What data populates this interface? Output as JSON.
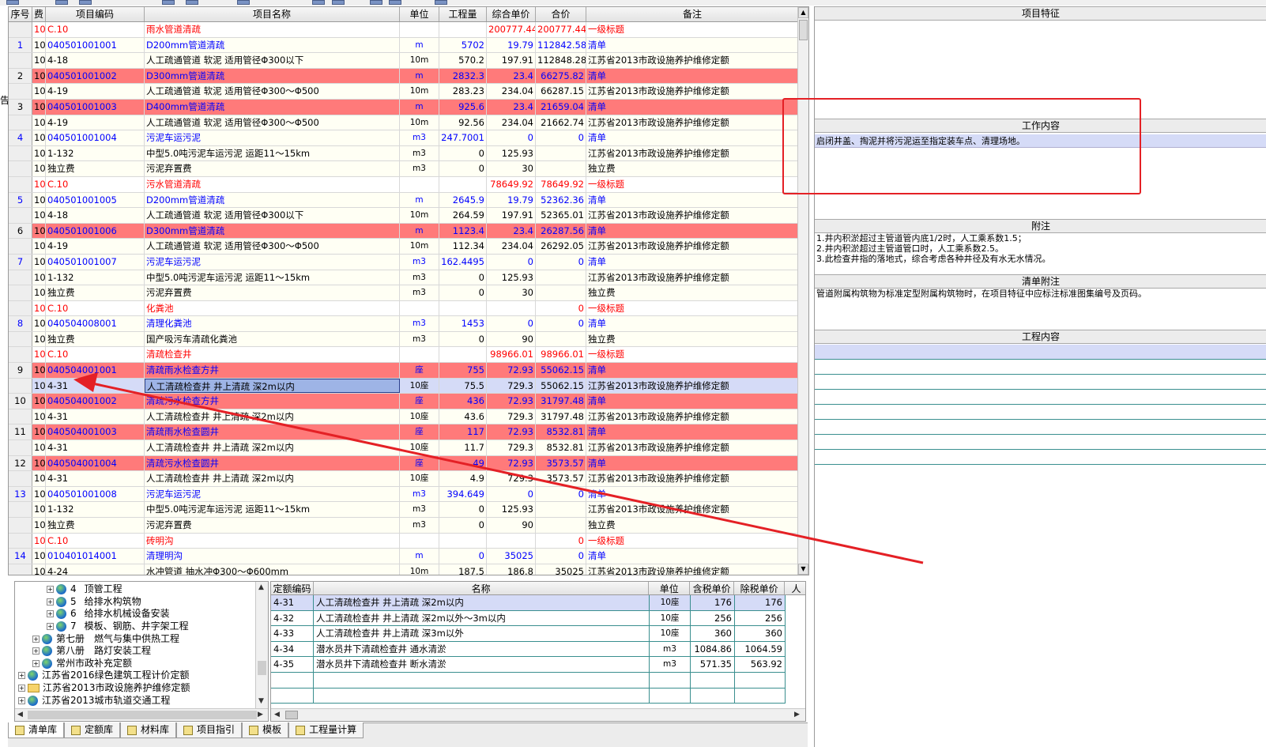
{
  "left_edge_glyph": "告",
  "main_grid": {
    "columns": [
      "序号",
      "费",
      "项目编码",
      "项目名称",
      "单位",
      "工程量",
      "综合单价",
      "合价",
      "备注"
    ],
    "rows": [
      {
        "type": "level1",
        "seq": "",
        "fee": "10",
        "code": "C.10",
        "name": "雨水管道清疏",
        "unit": "",
        "qty": "",
        "price": "200777.44",
        "total": "200777.44",
        "note": "一级标题"
      },
      {
        "type": "item",
        "seq": "1",
        "fee": "10",
        "code": "040501001001",
        "name": "D200mm管道清疏",
        "unit": "m",
        "qty": "5702",
        "price": "19.79",
        "total": "112842.58",
        "note": "清单"
      },
      {
        "type": "quota",
        "seq": "",
        "fee": "10",
        "code": "4-18",
        "name": "人工疏通管道 软泥 适用管径Φ300以下",
        "unit": "10m",
        "qty": "570.2",
        "price": "197.91",
        "total": "112848.28",
        "note": "江苏省2013市政设施养护维修定额"
      },
      {
        "type": "err",
        "seq": "2",
        "fee": "10",
        "code": "040501001002",
        "name": "D300mm管道清疏",
        "unit": "m",
        "qty": "2832.3",
        "price": "23.4",
        "total": "66275.82",
        "note": "清单"
      },
      {
        "type": "quota",
        "seq": "",
        "fee": "10",
        "code": "4-19",
        "name": "人工疏通管道 软泥 适用管径Φ300～Φ500",
        "unit": "10m",
        "qty": "283.23",
        "price": "234.04",
        "total": "66287.15",
        "note": "江苏省2013市政设施养护维修定额"
      },
      {
        "type": "err",
        "seq": "3",
        "fee": "10",
        "code": "040501001003",
        "name": "D400mm管道清疏",
        "unit": "m",
        "qty": "925.6",
        "price": "23.4",
        "total": "21659.04",
        "note": "清单"
      },
      {
        "type": "quota",
        "seq": "",
        "fee": "10",
        "code": "4-19",
        "name": "人工疏通管道 软泥 适用管径Φ300～Φ500",
        "unit": "10m",
        "qty": "92.56",
        "price": "234.04",
        "total": "21662.74",
        "note": "江苏省2013市政设施养护维修定额"
      },
      {
        "type": "item",
        "seq": "4",
        "fee": "10",
        "code": "040501001004",
        "name": "污泥车运污泥",
        "unit": "m3",
        "qty": "247.7001",
        "price": "0",
        "total": "0",
        "note": "清单"
      },
      {
        "type": "quota",
        "seq": "",
        "fee": "10",
        "code": "1-132",
        "name": "中型5.0吨污泥车运污泥 运距11～15km",
        "unit": "m3",
        "qty": "0",
        "price": "125.93",
        "total": "",
        "note": "江苏省2013市政设施养护维修定额"
      },
      {
        "type": "quota",
        "seq": "",
        "fee": "10",
        "code": "独立费",
        "name": "污泥弃置费",
        "unit": "m3",
        "qty": "0",
        "price": "30",
        "total": "",
        "note": "独立费"
      },
      {
        "type": "level1",
        "seq": "",
        "fee": "10",
        "code": "C.10",
        "name": "污水管道清疏",
        "unit": "",
        "qty": "",
        "price": "78649.92",
        "total": "78649.92",
        "note": "一级标题"
      },
      {
        "type": "item",
        "seq": "5",
        "fee": "10",
        "code": "040501001005",
        "name": "D200mm管道清疏",
        "unit": "m",
        "qty": "2645.9",
        "price": "19.79",
        "total": "52362.36",
        "note": "清单"
      },
      {
        "type": "quota",
        "seq": "",
        "fee": "10",
        "code": "4-18",
        "name": "人工疏通管道 软泥 适用管径Φ300以下",
        "unit": "10m",
        "qty": "264.59",
        "price": "197.91",
        "total": "52365.01",
        "note": "江苏省2013市政设施养护维修定额"
      },
      {
        "type": "err",
        "seq": "6",
        "fee": "10",
        "code": "040501001006",
        "name": "D300mm管道清疏",
        "unit": "m",
        "qty": "1123.4",
        "price": "23.4",
        "total": "26287.56",
        "note": "清单"
      },
      {
        "type": "quota",
        "seq": "",
        "fee": "10",
        "code": "4-19",
        "name": "人工疏通管道 软泥 适用管径Φ300～Φ500",
        "unit": "10m",
        "qty": "112.34",
        "price": "234.04",
        "total": "26292.05",
        "note": "江苏省2013市政设施养护维修定额"
      },
      {
        "type": "item",
        "seq": "7",
        "fee": "10",
        "code": "040501001007",
        "name": "污泥车运污泥",
        "unit": "m3",
        "qty": "162.4495",
        "price": "0",
        "total": "0",
        "note": "清单"
      },
      {
        "type": "quota",
        "seq": "",
        "fee": "10",
        "code": "1-132",
        "name": "中型5.0吨污泥车运污泥 运距11～15km",
        "unit": "m3",
        "qty": "0",
        "price": "125.93",
        "total": "",
        "note": "江苏省2013市政设施养护维修定额"
      },
      {
        "type": "quota",
        "seq": "",
        "fee": "10",
        "code": "独立费",
        "name": "污泥弃置费",
        "unit": "m3",
        "qty": "0",
        "price": "30",
        "total": "",
        "note": "独立费"
      },
      {
        "type": "level1",
        "seq": "",
        "fee": "10",
        "code": "C.10",
        "name": "化粪池",
        "unit": "",
        "qty": "",
        "price": "",
        "total": "0",
        "note": "一级标题"
      },
      {
        "type": "item",
        "seq": "8",
        "fee": "10",
        "code": "040504008001",
        "name": "清理化粪池",
        "unit": "m3",
        "qty": "1453",
        "price": "0",
        "total": "0",
        "note": "清单"
      },
      {
        "type": "quota",
        "seq": "",
        "fee": "10",
        "code": "独立费",
        "name": "国产吸污车清疏化粪池",
        "unit": "m3",
        "qty": "0",
        "price": "90",
        "total": "",
        "note": "独立费"
      },
      {
        "type": "level1",
        "seq": "",
        "fee": "10",
        "code": "C.10",
        "name": "清疏检查井",
        "unit": "",
        "qty": "",
        "price": "98966.01",
        "total": "98966.01",
        "note": "一级标题"
      },
      {
        "type": "err",
        "seq": "9",
        "fee": "10",
        "code": "040504001001",
        "name": "清疏雨水检查方井",
        "unit": "座",
        "qty": "755",
        "price": "72.93",
        "total": "55062.15",
        "note": "清单"
      },
      {
        "type": "sel",
        "seq": "",
        "fee": "10",
        "code": "4-31",
        "name": "人工清疏检查井 井上清疏 深2m以内",
        "unit": "10座",
        "qty": "75.5",
        "price": "729.3",
        "total": "55062.15",
        "note": "江苏省2013市政设施养护维修定额"
      },
      {
        "type": "err",
        "seq": "10",
        "fee": "10",
        "code": "040504001002",
        "name": "清疏污水检查方井",
        "unit": "座",
        "qty": "436",
        "price": "72.93",
        "total": "31797.48",
        "note": "清单"
      },
      {
        "type": "quota",
        "seq": "",
        "fee": "10",
        "code": "4-31",
        "name": "人工清疏检查井 井上清疏 深2m以内",
        "unit": "10座",
        "qty": "43.6",
        "price": "729.3",
        "total": "31797.48",
        "note": "江苏省2013市政设施养护维修定额"
      },
      {
        "type": "err",
        "seq": "11",
        "fee": "10",
        "code": "040504001003",
        "name": "清疏雨水检查圆井",
        "unit": "座",
        "qty": "117",
        "price": "72.93",
        "total": "8532.81",
        "note": "清单"
      },
      {
        "type": "quota",
        "seq": "",
        "fee": "10",
        "code": "4-31",
        "name": "人工清疏检查井 井上清疏 深2m以内",
        "unit": "10座",
        "qty": "11.7",
        "price": "729.3",
        "total": "8532.81",
        "note": "江苏省2013市政设施养护维修定额"
      },
      {
        "type": "err",
        "seq": "12",
        "fee": "10",
        "code": "040504001004",
        "name": "清疏污水检查圆井",
        "unit": "座",
        "qty": "49",
        "price": "72.93",
        "total": "3573.57",
        "note": "清单"
      },
      {
        "type": "quota",
        "seq": "",
        "fee": "10",
        "code": "4-31",
        "name": "人工清疏检查井 井上清疏 深2m以内",
        "unit": "10座",
        "qty": "4.9",
        "price": "729.3",
        "total": "3573.57",
        "note": "江苏省2013市政设施养护维修定额"
      },
      {
        "type": "item",
        "seq": "13",
        "fee": "10",
        "code": "040501001008",
        "name": "污泥车运污泥",
        "unit": "m3",
        "qty": "394.649",
        "price": "0",
        "total": "0",
        "note": "清单"
      },
      {
        "type": "quota",
        "seq": "",
        "fee": "10",
        "code": "1-132",
        "name": "中型5.0吨污泥车运污泥 运距11～15km",
        "unit": "m3",
        "qty": "0",
        "price": "125.93",
        "total": "",
        "note": "江苏省2013市政设施养护维修定额"
      },
      {
        "type": "quota",
        "seq": "",
        "fee": "10",
        "code": "独立费",
        "name": "污泥弃置费",
        "unit": "m3",
        "qty": "0",
        "price": "90",
        "total": "",
        "note": "独立费"
      },
      {
        "type": "level1",
        "seq": "",
        "fee": "10",
        "code": "C.10",
        "name": "砖明沟",
        "unit": "",
        "qty": "",
        "price": "",
        "total": "0",
        "note": "一级标题"
      },
      {
        "type": "item",
        "seq": "14",
        "fee": "10",
        "code": "010401014001",
        "name": "清理明沟",
        "unit": "m",
        "qty": "0",
        "price": "35025",
        "total": "0",
        "note": "清单"
      },
      {
        "type": "quota",
        "seq": "",
        "fee": "10",
        "code": "4-24",
        "name": "水冲管道 抽水冲Φ300～Φ600mm",
        "unit": "10m",
        "qty": "187.5",
        "price": "186.8",
        "total": "35025",
        "note": "江苏省2013市政设施养护维修定额"
      }
    ]
  },
  "right_panel": {
    "feature_title": "项目特征",
    "work_title": "工作内容",
    "work_text": "启闭井盖、掏泥并将污泥运至指定装车点、清理场地。",
    "note_title": "附注",
    "note_text": "1.井内积淤超过主管道管内底1/2时，人工乘系数1.5；\n2.井内积淤超过主管道管口时，人工乘系数2.5。\n3.此检查井指的落地式，综合考虑各种井径及有水无水情况。",
    "list_note_title": "清单附注",
    "list_note_text": "管道附属构筑物为标准定型附属构筑物时，在项目特征中应标注标准图集编号及页码。",
    "content_title": "工程内容"
  },
  "tree": {
    "nodes": [
      {
        "num": "4",
        "label": "顶管工程",
        "icon": "globe-icon"
      },
      {
        "num": "5",
        "label": "给排水构筑物",
        "icon": "globe-icon"
      },
      {
        "num": "6",
        "label": "给排水机械设备安装",
        "icon": "globe-icon"
      },
      {
        "num": "7",
        "label": "模板、钢筋、井字架工程",
        "icon": "globe-icon"
      },
      {
        "num": "",
        "label": "第七册　燃气与集中供热工程",
        "icon": "globe-icon"
      },
      {
        "num": "",
        "label": "第八册　路灯安装工程",
        "icon": "globe-icon"
      },
      {
        "num": "",
        "label": "常州市政补充定额",
        "icon": "globe-icon"
      },
      {
        "num": "",
        "label": "江苏省2016绿色建筑工程计价定额",
        "icon": "globe-icon"
      },
      {
        "num": "",
        "label": "江苏省2013市政设施养护维修定额",
        "icon": "folder-open-icon"
      },
      {
        "num": "",
        "label": "江苏省2013城市轨道交通工程",
        "icon": "globe-icon"
      }
    ]
  },
  "quota_grid": {
    "columns": [
      "定额编码",
      "名称",
      "单位",
      "含税单价",
      "除税单价",
      "人"
    ],
    "rows": [
      {
        "code": "4-31",
        "name": "人工清疏检查井 井上清疏 深2m以内",
        "unit": "10座",
        "p1": "176",
        "p2": "176"
      },
      {
        "code": "4-32",
        "name": "人工清疏检查井 井上清疏 深2m以外～3m以内",
        "unit": "10座",
        "p1": "256",
        "p2": "256"
      },
      {
        "code": "4-33",
        "name": "人工清疏检查井 井上清疏 深3m以外",
        "unit": "10座",
        "p1": "360",
        "p2": "360"
      },
      {
        "code": "4-34",
        "name": "潜水员井下清疏检查井 通水清淤",
        "unit": "m3",
        "p1": "1084.86",
        "p2": "1064.59"
      },
      {
        "code": "4-35",
        "name": "潜水员井下清疏检查井 断水清淤",
        "unit": "m3",
        "p1": "571.35",
        "p2": "563.92"
      }
    ]
  },
  "bottom_tabs": [
    "清单库",
    "定额库",
    "材料库",
    "项目指引",
    "模板",
    "工程量计算"
  ],
  "colors": {
    "error_row": "#ff7a7a",
    "selected_row": "#d5dbf7",
    "annotation": "#e42025"
  }
}
